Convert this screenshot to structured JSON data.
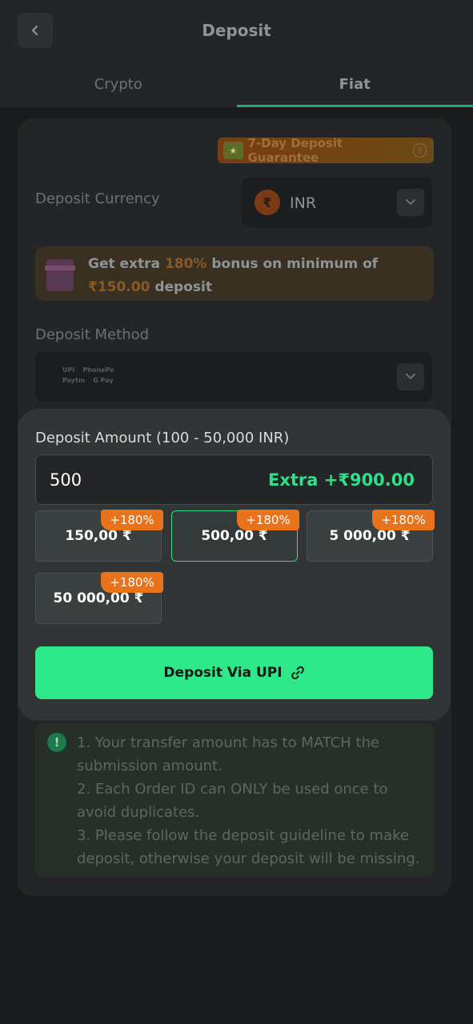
{
  "header": {
    "title": "Deposit"
  },
  "tabs": [
    {
      "label": "Crypto"
    },
    {
      "label": "Fiat"
    }
  ],
  "guarantee": {
    "label": "7-Day Deposit Guarantee"
  },
  "currency": {
    "label": "Deposit Currency",
    "code": "INR",
    "symbol": "₹"
  },
  "bonus": {
    "prefix": "Get extra",
    "percent": "180%",
    "middle": "bonus on minimum of",
    "amount": "₹150.00",
    "suffix": "deposit"
  },
  "method": {
    "label": "Deposit Method",
    "logos": [
      "UPI",
      "PhonePe",
      "Paytm",
      "G Pay"
    ]
  },
  "amount": {
    "label": "Deposit Amount (100 - 50,000 INR)",
    "value": "500",
    "extra": "Extra +₹900.00",
    "chips": [
      {
        "value": "150,00 ₹",
        "badge": "+180%"
      },
      {
        "value": "500,00 ₹",
        "badge": "+180%"
      },
      {
        "value": "5 000,00 ₹",
        "badge": "+180%"
      },
      {
        "value": "50 000,00 ₹",
        "badge": "+180%"
      }
    ],
    "button_label": "Deposit Via UPI"
  },
  "notes": [
    "1. Your transfer amount has to MATCH the submission amount.",
    "2. Each Order ID can ONLY be used once to avoid duplicates.",
    "3. Please follow the deposit guideline to make deposit, otherwise your deposit will be missing."
  ],
  "colors": {
    "accent": "#2ee88a",
    "badge": "#e8731c",
    "background": "#1a1b1c"
  }
}
